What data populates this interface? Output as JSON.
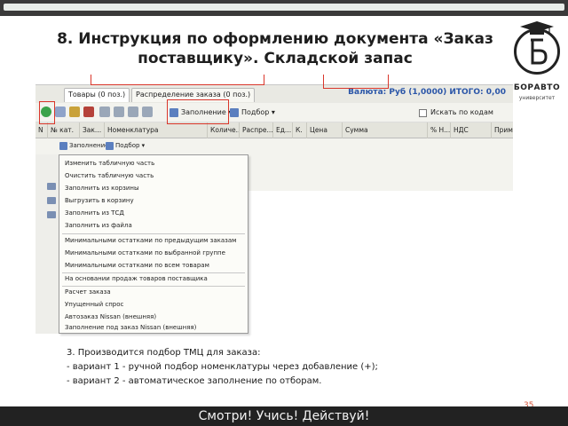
{
  "slide": {
    "title_line1": "8. Инструкция по оформлению документа «Заказ",
    "title_line2": "поставщику». Складской запас",
    "page_number": "35",
    "footer": "Смотри! Учись! Действуй!"
  },
  "logo": {
    "name": "БОРАВТО",
    "sub": "университет",
    "icon": "graduation-cap-logo"
  },
  "app": {
    "tabs": [
      {
        "label": "Товары (0 поз.)",
        "active": true
      },
      {
        "label": "Распределение заказа (0 поз.)",
        "active": false
      }
    ],
    "currency_summary": "Валюта: Руб (1,0000) ИТОГО: 0,00",
    "toolbar": {
      "fill_label": "Заполнение",
      "select_label": "Подбор",
      "search_checkbox_label": "Искать по кодам поставщика"
    },
    "columns": [
      "N",
      "№ кат.",
      "Зак...",
      "Номенклатура",
      "Количе...",
      "Распре...",
      "Ед...",
      "К.",
      "Цена",
      "Сумма",
      "% Н...",
      "НДС",
      "Прим"
    ],
    "sub_toolbar": {
      "fill_label": "Заполнение",
      "select_label": "Подбор"
    },
    "menu": {
      "group1": [
        "Изменить табличную часть",
        "Очистить табличную часть",
        "Заполнить из корзины",
        "Выгрузить в корзину",
        "Заполнить из ТСД",
        "Заполнить из файла"
      ],
      "group2": [
        "Минимальными остатками по предыдущим заказам",
        "Минимальными остатками по выбранной группе",
        "Минимальными остатками по всем товарам"
      ],
      "group3": [
        "На основании продаж товаров поставщика"
      ],
      "group4": [
        "Расчет заказа",
        "Упущенный спрос",
        "Автозаказ Nissan (внешняя)",
        "Заполнение под заказ Nissan (внешняя)"
      ]
    }
  },
  "body": {
    "line1": "3. Производится подбор ТМЦ для заказа:",
    "line2": "- вариант 1 - ручной подбор номенклатуры через добавление (+);",
    "line3": "- вариант 2 - автоматическое заполнение по отборам."
  },
  "colors": {
    "highlight_red": "#d9362b",
    "currency_blue": "#2b56a8",
    "footer_bg": "#222222",
    "page_number": "#d6553a"
  }
}
